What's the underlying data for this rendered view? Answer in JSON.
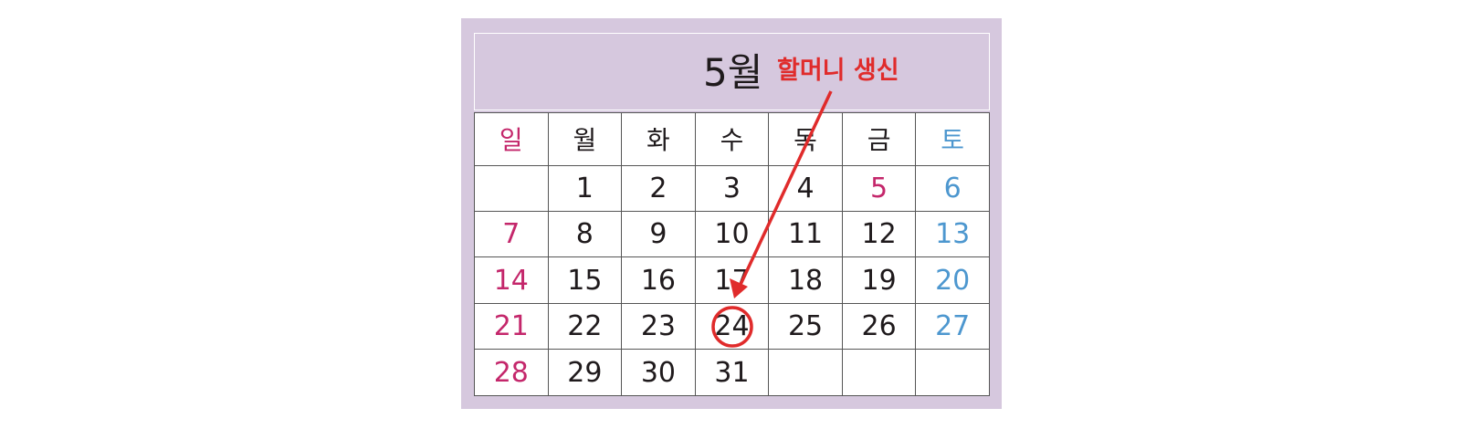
{
  "calendar": {
    "month": "5월",
    "annotation": "할머니 생신",
    "highlighted_day": "24",
    "weekdays": [
      "일",
      "월",
      "화",
      "수",
      "목",
      "금",
      "토"
    ],
    "weeks": [
      [
        "",
        "1",
        "2",
        "3",
        "4",
        "5",
        "6"
      ],
      [
        "7",
        "8",
        "9",
        "10",
        "11",
        "12",
        "13"
      ],
      [
        "14",
        "15",
        "16",
        "17",
        "18",
        "19",
        "20"
      ],
      [
        "21",
        "22",
        "23",
        "24",
        "25",
        "26",
        "27"
      ],
      [
        "28",
        "29",
        "30",
        "31",
        "",
        "",
        ""
      ]
    ]
  },
  "colors": {
    "background_frame": "#d6c8de",
    "sunday": "#c4276b",
    "saturday": "#4d97cf",
    "holiday": "#c4276b",
    "annotation": "#e02b2b",
    "text": "#1f1a1c"
  }
}
